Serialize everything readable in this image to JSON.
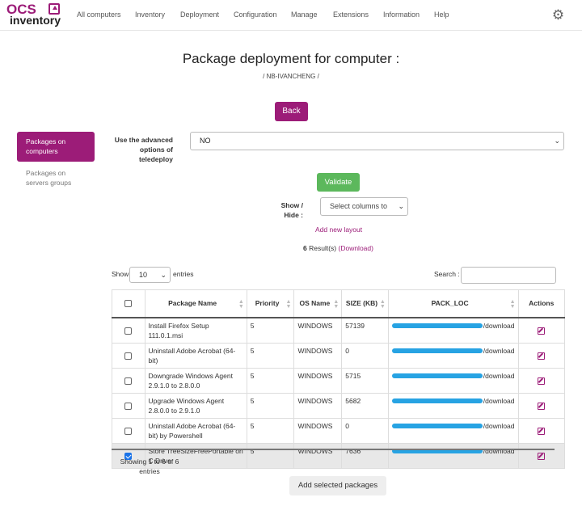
{
  "app": {
    "logo_top": "OCS",
    "logo_bottom": "inventory"
  },
  "nav": [
    "All computers",
    "Inventory",
    "Deployment",
    "Configuration",
    "Manage",
    "Extensions",
    "Information",
    "Help"
  ],
  "page": {
    "title": "Package deployment for computer :",
    "computer": "/ NB-IVANCHENG /",
    "back_label": "Back"
  },
  "sidebar": {
    "items": [
      {
        "label": "Packages on computers",
        "active": true
      },
      {
        "label": "Packages on servers groups",
        "active": false
      }
    ]
  },
  "advanced": {
    "label": "Use the advanced options of teledeploy",
    "value": "NO"
  },
  "validate_label": "Validate",
  "show_hide": {
    "label": "Show / Hide :",
    "placeholder": "Select columns to"
  },
  "add_layout_label": "Add new layout",
  "results": {
    "count": "6",
    "text": "Result(s)",
    "download": "(Download)"
  },
  "table_controls": {
    "show_label": "Show",
    "length_value": "10",
    "entries_label": "entries",
    "search_label": "Search :"
  },
  "table": {
    "headers": [
      "Package Name",
      "Priority",
      "OS Name",
      "SIZE (KB)",
      "PACK_LOC",
      "Actions"
    ],
    "rows": [
      {
        "checked": false,
        "name": "Install Firefox Setup 111.0.1.msi",
        "priority": "5",
        "os": "WINDOWS",
        "size": "57139",
        "loc_suffix": "/download"
      },
      {
        "checked": false,
        "name": "Uninstall Adobe Acrobat (64-bit)",
        "priority": "5",
        "os": "WINDOWS",
        "size": "0",
        "loc_suffix": "/download"
      },
      {
        "checked": false,
        "name": "Downgrade Windows Agent 2.9.1.0 to 2.8.0.0",
        "priority": "5",
        "os": "WINDOWS",
        "size": "5715",
        "loc_suffix": "/download"
      },
      {
        "checked": false,
        "name": "Upgrade Windows Agent 2.8.0.0 to 2.9.1.0",
        "priority": "5",
        "os": "WINDOWS",
        "size": "5682",
        "loc_suffix": "/download"
      },
      {
        "checked": false,
        "name": "Uninstall Adobe Acrobat (64-bit) by Powershell",
        "priority": "5",
        "os": "WINDOWS",
        "size": "0",
        "loc_suffix": "/download"
      },
      {
        "checked": true,
        "name": "Store TreeSizeFreePortable on C Drive",
        "priority": "5",
        "os": "WINDOWS",
        "size": "7636",
        "loc_suffix": "/download"
      }
    ]
  },
  "showing_text": "Showing 1 to 6 of 6 entries",
  "add_selected_label": "Add selected packages",
  "colors": {
    "brand": "#9c1c78",
    "success": "#5cb85c",
    "redaction": "#27a3e3"
  }
}
